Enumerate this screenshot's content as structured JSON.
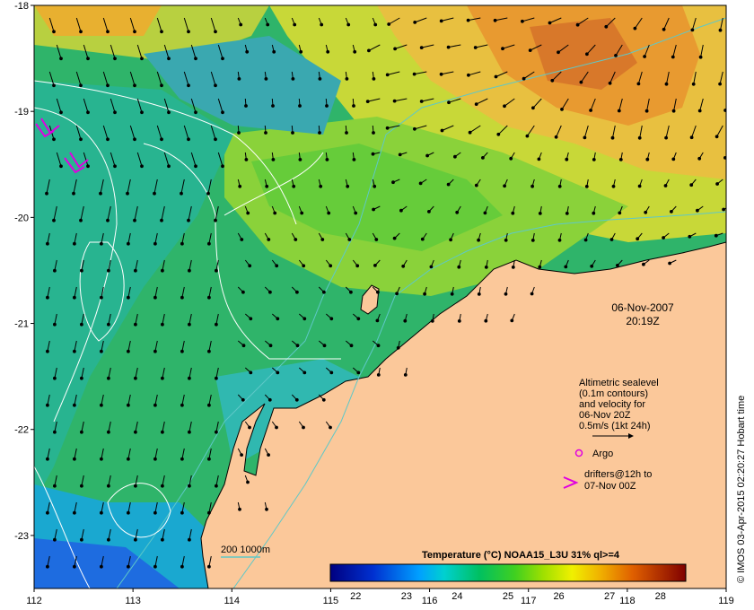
{
  "map": {
    "date": "06-Nov-2007",
    "time": "20:19Z",
    "x_ticks": [
      "112",
      "113",
      "114",
      "115",
      "116",
      "117",
      "118",
      "119"
    ],
    "y_ticks": [
      "-18",
      "-19",
      "-20",
      "-21",
      "-22",
      "-23"
    ],
    "lon_range": [
      112,
      119
    ],
    "lat_range": [
      -23.5,
      -18
    ],
    "credit": "© IMOS 03-Apr-2015 02:20:27 Hobart time"
  },
  "legend": {
    "altimetry_lines": [
      "Altimetric sealevel",
      "(0.1m contours)",
      "and velocity for",
      "06-Nov 20Z",
      "0.5m/s (1kt 24h)"
    ],
    "argo_label": "Argo",
    "drifters_lines": [
      "drifters@12h to",
      "07-Nov 00Z"
    ],
    "isobath_label": "200  1000m"
  },
  "colorbar": {
    "title": "Temperature (°C) NOAA15_L3U 31% ql>=4",
    "ticks": [
      "22",
      "23",
      "24",
      "25",
      "26",
      "27",
      "28"
    ],
    "range": [
      21.5,
      28.5
    ]
  },
  "colors": {
    "land": "#fbc89a",
    "isobath": "#5ec8c8",
    "argo": "#e000e0",
    "drifter": "#e000e0",
    "contour": "#ffffff"
  }
}
